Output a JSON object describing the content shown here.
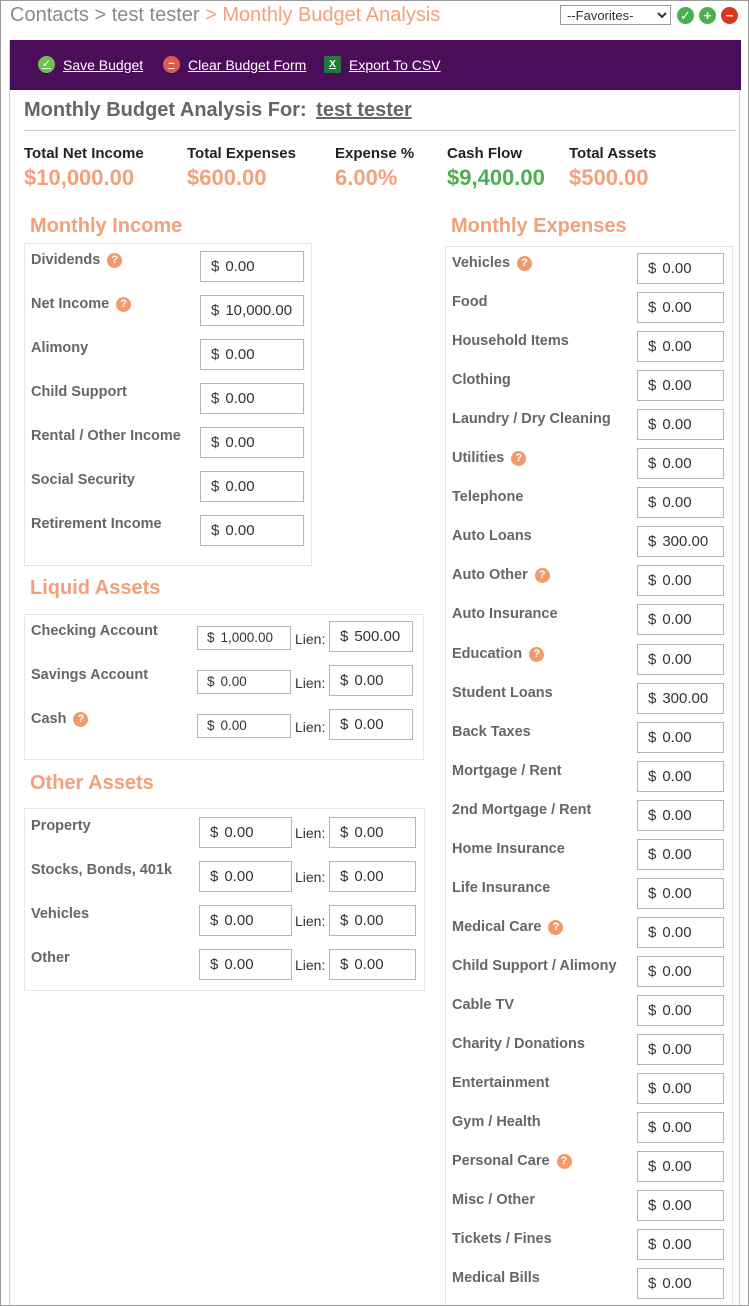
{
  "breadcrumb": {
    "contacts": "Contacts",
    "sep1": ">",
    "client": "test tester",
    "sep2": ">",
    "current": "Monthly Budget Analysis"
  },
  "favorites": {
    "selected": "--Favorites-"
  },
  "toolbar": {
    "save": "Save Budget",
    "clear": "Clear Budget Form",
    "export": "Export To CSV"
  },
  "title": {
    "prefix": "Monthly Budget Analysis For:",
    "name": "test tester"
  },
  "summary": [
    {
      "label": "Total Net Income",
      "value": "$10,000.00"
    },
    {
      "label": "Total Expenses",
      "value": "$600.00"
    },
    {
      "label": "Expense %",
      "value": "6.00%"
    },
    {
      "label": "Cash Flow",
      "value": "$9,400.00"
    },
    {
      "label": "Total Assets",
      "value": "$500.00"
    }
  ],
  "currency": "$",
  "lien_label": "Lien:",
  "income": {
    "title": "Monthly Income",
    "rows": [
      {
        "label": "Dividends",
        "value": "0.00"
      },
      {
        "label": "Net Income",
        "value": "10,000.00"
      },
      {
        "label": "Alimony",
        "value": "0.00"
      },
      {
        "label": "Child Support",
        "value": "0.00"
      },
      {
        "label": "Rental / Other Income",
        "value": "0.00"
      },
      {
        "label": "Social Security",
        "value": "0.00"
      },
      {
        "label": "Retirement Income",
        "value": "0.00"
      }
    ]
  },
  "liquid": {
    "title": "Liquid Assets",
    "rows": [
      {
        "label": "Checking Account",
        "value": "1,000.00",
        "lien": "500.00"
      },
      {
        "label": "Savings Account",
        "value": "0.00",
        "lien": "0.00"
      },
      {
        "label": "Cash",
        "value": "0.00",
        "lien": "0.00"
      }
    ]
  },
  "other": {
    "title": "Other Assets",
    "rows": [
      {
        "label": "Property",
        "value": "0.00",
        "lien": "0.00"
      },
      {
        "label": "Stocks, Bonds, 401k",
        "value": "0.00",
        "lien": "0.00"
      },
      {
        "label": "Vehicles",
        "value": "0.00",
        "lien": "0.00"
      },
      {
        "label": "Other",
        "value": "0.00",
        "lien": "0.00"
      }
    ]
  },
  "expenses": {
    "title": "Monthly Expenses",
    "rows": [
      {
        "label": "Vehicles",
        "value": "0.00"
      },
      {
        "label": "Food",
        "value": "0.00"
      },
      {
        "label": "Household Items",
        "value": "0.00"
      },
      {
        "label": "Clothing",
        "value": "0.00"
      },
      {
        "label": "Laundry / Dry Cleaning",
        "value": "0.00"
      },
      {
        "label": "Utilities",
        "value": "0.00"
      },
      {
        "label": "Telephone",
        "value": "0.00"
      },
      {
        "label": "Auto Loans",
        "value": "300.00"
      },
      {
        "label": "Auto Other",
        "value": "0.00"
      },
      {
        "label": "Auto Insurance",
        "value": "0.00"
      },
      {
        "label": "Education",
        "value": "0.00"
      },
      {
        "label": "Student Loans",
        "value": "300.00"
      },
      {
        "label": "Back Taxes",
        "value": "0.00"
      },
      {
        "label": "Mortgage / Rent",
        "value": "0.00"
      },
      {
        "label": "2nd Mortgage / Rent",
        "value": "0.00"
      },
      {
        "label": "Home Insurance",
        "value": "0.00"
      },
      {
        "label": "Life Insurance",
        "value": "0.00"
      },
      {
        "label": "Medical Care",
        "value": "0.00"
      },
      {
        "label": "Child Support / Alimony",
        "value": "0.00"
      },
      {
        "label": "Cable TV",
        "value": "0.00"
      },
      {
        "label": "Charity / Donations",
        "value": "0.00"
      },
      {
        "label": "Entertainment",
        "value": "0.00"
      },
      {
        "label": "Gym / Health",
        "value": "0.00"
      },
      {
        "label": "Personal Care",
        "value": "0.00"
      },
      {
        "label": "Misc / Other",
        "value": "0.00"
      },
      {
        "label": "Tickets / Fines",
        "value": "0.00"
      },
      {
        "label": "Medical Bills",
        "value": "0.00"
      }
    ]
  },
  "help_glyph": "?",
  "icons": {
    "save": "check-icon",
    "clear": "minus-icon",
    "export": "excel-icon",
    "fav_ok": "check-icon",
    "fav_add": "plus-icon",
    "fav_remove": "minus-icon"
  },
  "colors": {
    "accent": "#f4a07a",
    "toolbar": "#4a0d5a",
    "positive": "#4caf50"
  }
}
